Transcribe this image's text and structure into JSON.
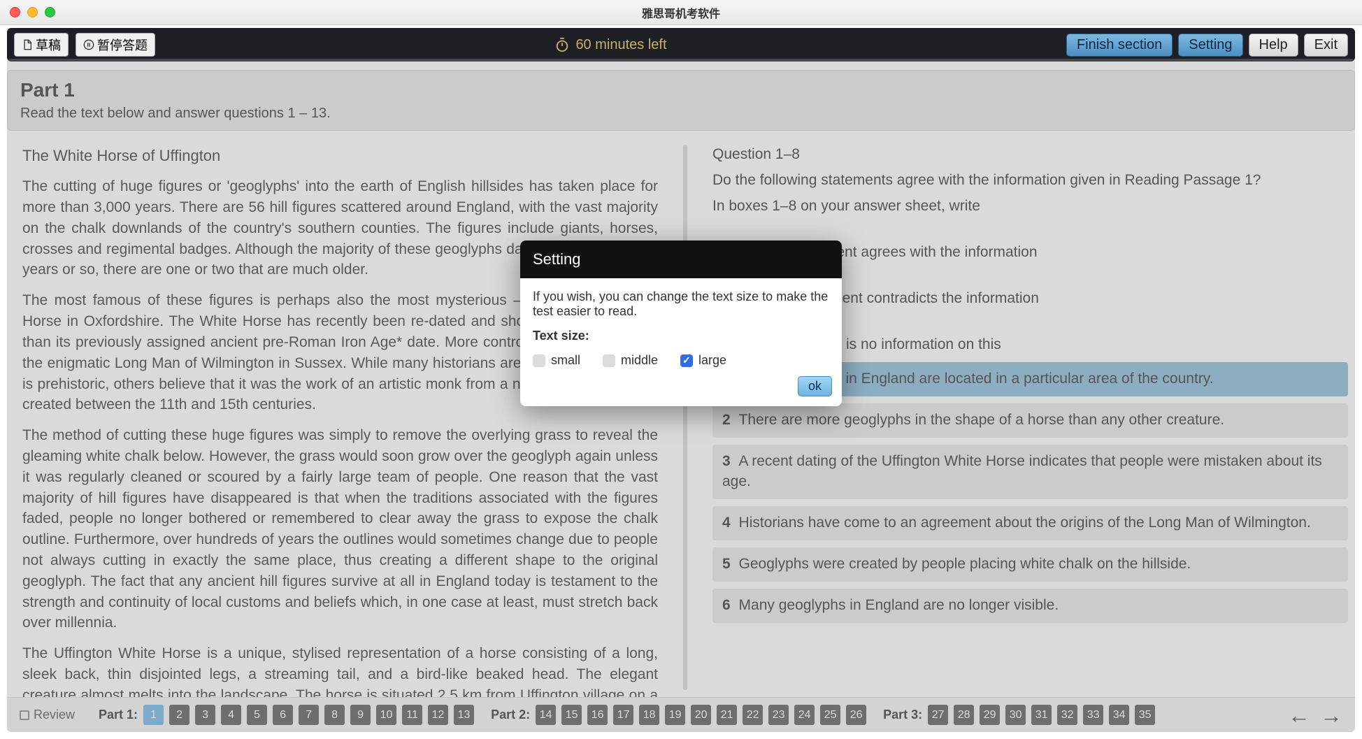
{
  "window": {
    "title": "雅思哥机考软件"
  },
  "toolbar": {
    "draft": "草稿",
    "pause": "暂停答题",
    "timer": "60 minutes left",
    "finish": "Finish section",
    "setting": "Setting",
    "help": "Help",
    "exit": "Exit"
  },
  "part_header": {
    "title": "Part 1",
    "instruction": "Read the text below and answer questions 1 – 13."
  },
  "passage": {
    "title": "The White Horse of Uffington",
    "paragraphs": [
      "The cutting of huge figures or 'geoglyphs' into the earth of English hillsides has taken place for more than 3,000 years. There are 56 hill figures scattered around England, with the vast majority on the chalk downlands of the country's southern counties. The figures include giants, horses, crosses and regimental badges. Although the majority of these geoglyphs date within the last 300 years or so, there are one or two that are much older.",
      "The most famous of these figures is perhaps also the most mysterious – the Uffington White Horse in Oxfordshire. The White Horse has recently been re-dated and shown to be even older than its previously assigned ancient pre-Roman Iron Age* date. More controversial is the date of the enigmatic Long Man of Wilmington in Sussex. While many historians are convinced the figure is prehistoric, others believe that it was the work of an artistic monk from a nearby priory and was created between the 11th and 15th centuries.",
      "The method of cutting these huge figures was simply to remove the overlying grass to reveal the gleaming white chalk below. However, the grass would soon grow over the geoglyph again unless it was regularly cleaned or scoured by a fairly large team of people. One reason that the vast majority of hill figures have disappeared is that when the traditions associated with the figures faded, people no longer bothered or remembered to clear away the grass to expose the chalk outline. Furthermore, over hundreds of years the outlines would sometimes change due to people not always cutting in exactly the same place, thus creating a different shape to the original geoglyph. The fact that any ancient hill figures survive at all in England today is testament to the strength and continuity of local customs and beliefs which, in one case at least, must stretch back over millennia.",
      "The Uffington White Horse is a unique, stylised representation of a horse consisting of a long, sleek back, thin disjointed legs, a streaming tail, and a bird-like beaked head. The elegant creature almost melts into the landscape. The horse is situated 2.5 km from Uffington village on a steep slope close to the Late"
    ]
  },
  "questions": {
    "heading": "Question 1–8",
    "intro1": "Do the following statements agree with the information given in Reading Passage 1?",
    "intro2": "In boxes 1–8 on your answer sheet, write",
    "legend": [
      "TRUE if the statement agrees with the information",
      "FALSE if the statement contradicts the information",
      "NOT GIVEN if there is no information on this"
    ],
    "items": [
      {
        "n": "1",
        "text": "Most geoglyphs in England are located in a particular area of the country.",
        "selected": true
      },
      {
        "n": "2",
        "text": "There are more geoglyphs in the shape of a horse than any other creature."
      },
      {
        "n": "3",
        "text": "A recent dating of the Uffington White Horse indicates that people were mistaken about its age."
      },
      {
        "n": "4",
        "text": "Historians have come to an agreement about the origins of the Long Man of Wilmington."
      },
      {
        "n": "5",
        "text": "Geoglyphs were created by people placing white chalk on the hillside."
      },
      {
        "n": "6",
        "text": "Many geoglyphs in England are no longer visible."
      }
    ]
  },
  "bottomnav": {
    "review": "Review",
    "parts": [
      {
        "label": "Part 1:",
        "nums": [
          "1",
          "2",
          "3",
          "4",
          "5",
          "6",
          "7",
          "8",
          "9",
          "10",
          "11",
          "12",
          "13"
        ],
        "active": "1"
      },
      {
        "label": "Part 2:",
        "nums": [
          "14",
          "15",
          "16",
          "17",
          "18",
          "19",
          "20",
          "21",
          "22",
          "23",
          "24",
          "25",
          "26"
        ]
      },
      {
        "label": "Part 3:",
        "nums": [
          "27",
          "28",
          "29",
          "30",
          "31",
          "32",
          "33",
          "34",
          "35"
        ]
      }
    ]
  },
  "dialog": {
    "title": "Setting",
    "body": "If you wish, you can change the text size to make the test easier to read.",
    "label": "Text size:",
    "options": {
      "small": "small",
      "middle": "middle",
      "large": "large"
    },
    "selected": "large",
    "ok": "ok"
  }
}
